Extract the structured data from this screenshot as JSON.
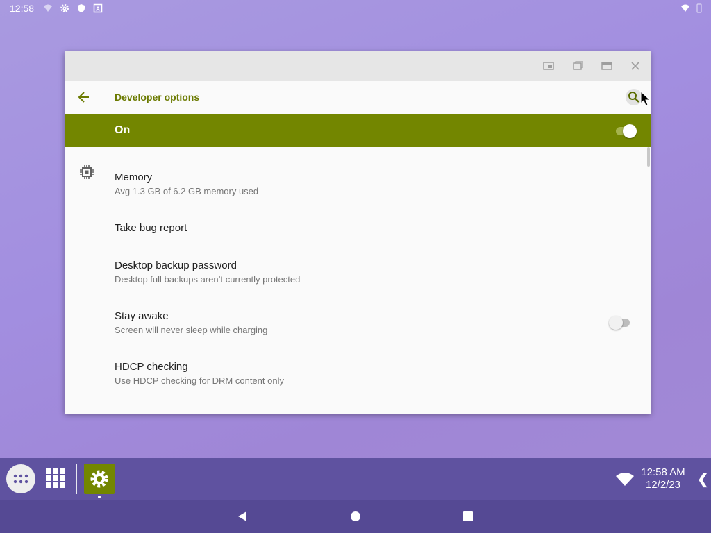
{
  "status_bar": {
    "time": "12:58",
    "icons": [
      "wifi-signal-icon",
      "gear-icon",
      "shield-icon",
      "a-letter-icon",
      "wifi-icon",
      "battery-icon"
    ]
  },
  "window": {
    "caption_buttons": [
      "picture-in-picture-icon",
      "restore-icon",
      "maximize-icon",
      "close-icon"
    ],
    "app_bar": {
      "title": "Developer options",
      "back_icon": "arrow-back-icon",
      "search_icon": "search-icon"
    },
    "master_switch": {
      "label": "On",
      "checked": true
    },
    "items": [
      {
        "title": "Memory",
        "summary": "Avg 1.3 GB of 6.2 GB memory used",
        "icon": "memory-chip-icon"
      },
      {
        "title": "Take bug report"
      },
      {
        "title": "Desktop backup password",
        "summary": "Desktop full backups aren’t currently protected"
      },
      {
        "title": "Stay awake",
        "summary": "Screen will never sleep while charging",
        "toggle": false
      },
      {
        "title": "HDCP checking",
        "summary": "Use HDCP checking for DRM content only"
      }
    ]
  },
  "taskbar": {
    "clock_time": "12:58 AM",
    "clock_date": "12/2/23",
    "expand_glyph": "❮",
    "apps": [
      "app-drawer-icon",
      "grid-icon",
      "settings-app-icon"
    ]
  },
  "navbar": {
    "buttons": [
      "back-triangle-icon",
      "home-circle-icon",
      "recents-square-icon"
    ]
  },
  "colors": {
    "accent": "#738600",
    "title_text": "#6b7a00",
    "taskbar": "#5f52a0",
    "navbar": "#554994"
  }
}
